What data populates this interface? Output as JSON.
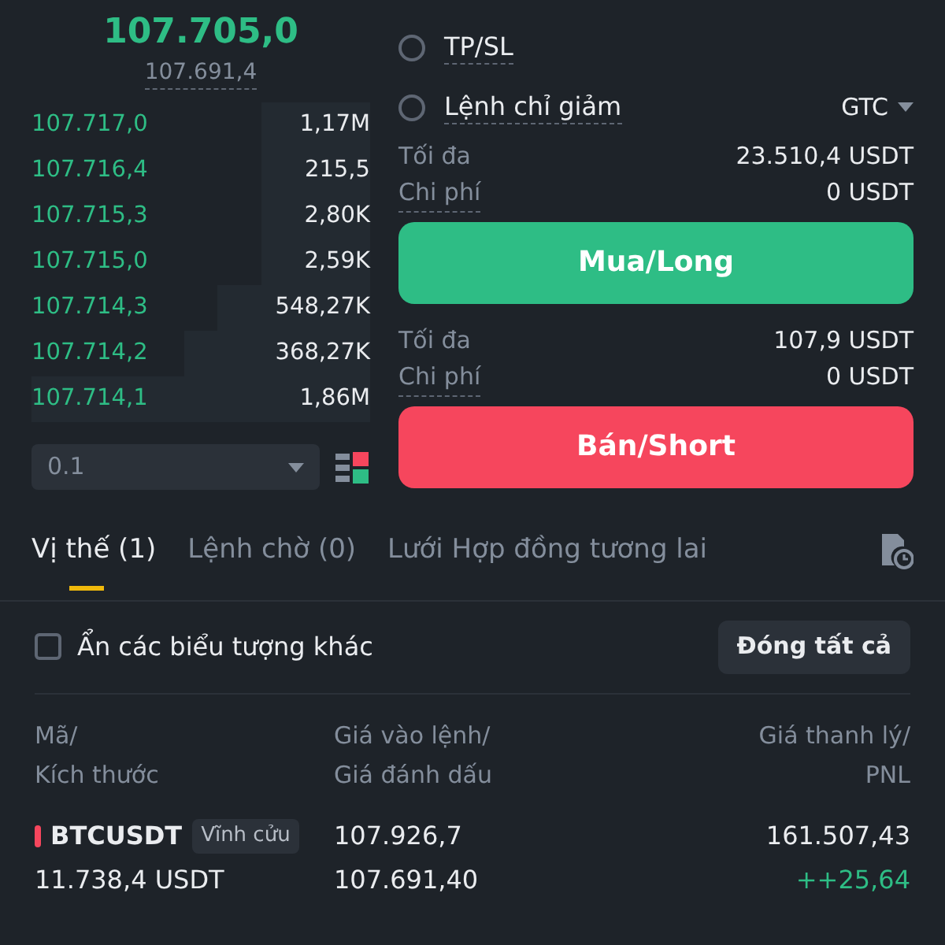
{
  "ticker": {
    "last_price": "107.705,0",
    "mark_price": "107.691,4"
  },
  "order_book": [
    {
      "price": "107.717,0",
      "amount": "1,17M"
    },
    {
      "price": "107.716,4",
      "amount": "215,5"
    },
    {
      "price": "107.715,3",
      "amount": "2,80K"
    },
    {
      "price": "107.715,0",
      "amount": "2,59K"
    },
    {
      "price": "107.714,3",
      "amount": "548,27K"
    },
    {
      "price": "107.714,2",
      "amount": "368,27K"
    },
    {
      "price": "107.714,1",
      "amount": "1,86M"
    }
  ],
  "depth_select": {
    "value": "0.1"
  },
  "options": [
    {
      "label": "TP/SL",
      "checked": false
    },
    {
      "label": "Lệnh chỉ giảm",
      "checked": false
    }
  ],
  "time_in_force": "GTC",
  "buy": {
    "max_label": "Tối đa",
    "max_value": "23.510,4 USDT",
    "cost_label": "Chi phí",
    "cost_value": "0 USDT",
    "button": "Mua/Long"
  },
  "sell": {
    "max_label": "Tối đa",
    "max_value": "107,9 USDT",
    "cost_label": "Chi phí",
    "cost_value": "0 USDT",
    "button": "Bán/Short"
  },
  "tabs": [
    {
      "label": "Vị thế (1)",
      "selected": true
    },
    {
      "label": "Lệnh chờ (0)",
      "selected": false
    },
    {
      "label": "Lưới Hợp đồng tương lai",
      "selected": false
    }
  ],
  "hide_others": {
    "label": "Ẩn các biểu tượng khác",
    "checked": false
  },
  "close_all": "Đóng tất cả",
  "columns": [
    {
      "line1": "Mã/",
      "line2": "Kích thước"
    },
    {
      "line1": "Giá vào lệnh/",
      "line2": "Giá đánh dấu"
    },
    {
      "line1": "Giá thanh lý/",
      "line2": "PNL"
    }
  ],
  "position": {
    "symbol": "BTCUSDT",
    "color": "#f6465d",
    "tag": "Vĩnh cửu",
    "size": "11.738,4 USDT",
    "entry_price": "107.926,7",
    "mark_price": "107.691,40",
    "liq_price": "161.507,43",
    "pnl": "++25,64"
  }
}
